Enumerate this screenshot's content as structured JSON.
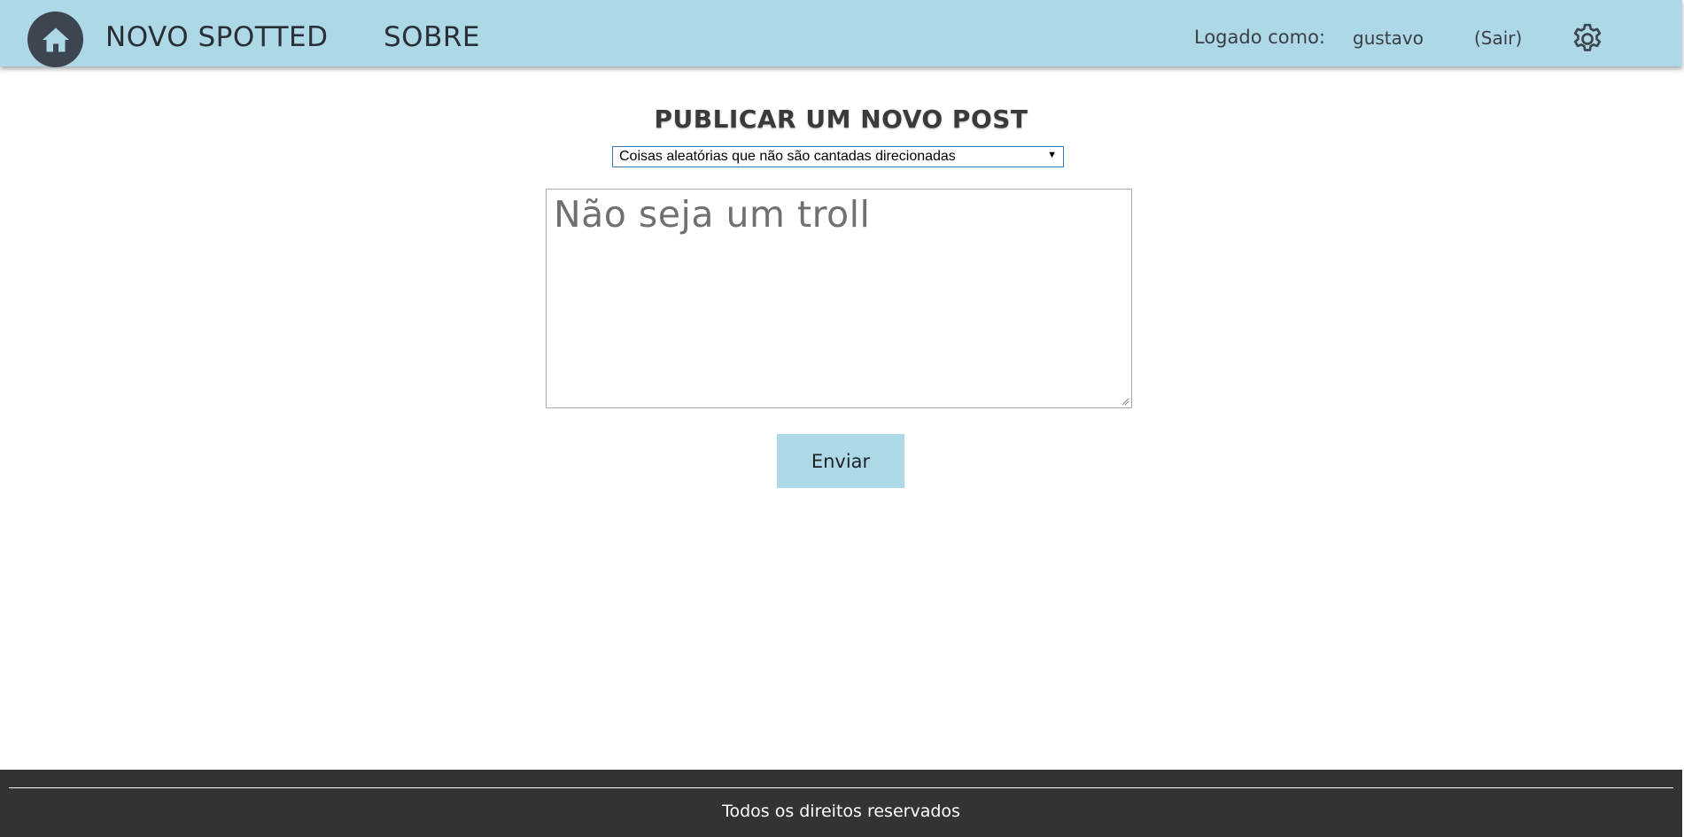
{
  "header": {
    "nav_new_post": "NOVO SPOTTED",
    "nav_about": "SOBRE",
    "logged_in_label": "Logado como:",
    "username": "gustavo",
    "logout_label": "(Sair)",
    "icons": [
      "home-icon",
      "gear-icon"
    ],
    "background_color": "#add8e6"
  },
  "main": {
    "title": "PUBLICAR UM NOVO POST",
    "category_select": {
      "selected": "Coisas aleatórias que não são cantadas direcionadas"
    },
    "post_textarea": {
      "placeholder": "Não seja um troll",
      "value": ""
    },
    "submit_label": "Enviar"
  },
  "footer": {
    "text": "Todos os direitos reservados",
    "background_color": "#333333"
  }
}
